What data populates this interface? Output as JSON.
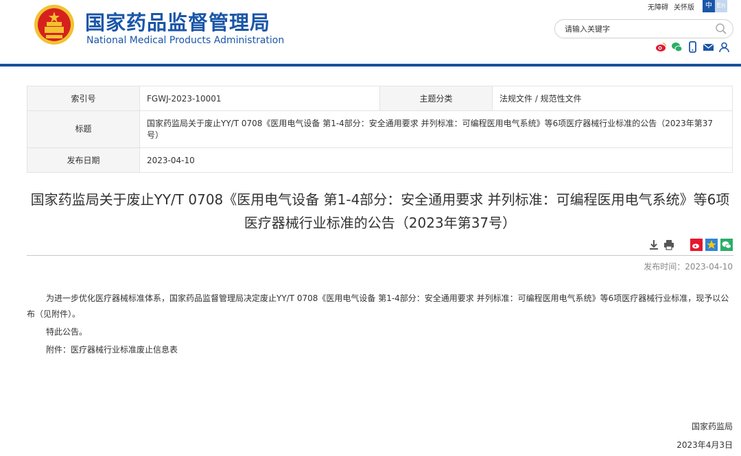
{
  "header": {
    "site_name_cn": "国家药品监督管理局",
    "site_name_en": "National Medical Products Administration",
    "top_links": [
      "无障碍",
      "关怀版"
    ],
    "lang_zh": "中",
    "lang_en": "En",
    "search_placeholder": "请输入关键字",
    "social_icons": [
      "weibo-icon",
      "wechat-icon",
      "mobile-icon",
      "mail-icon",
      "user-icon"
    ]
  },
  "info_table": {
    "index_label": "索引号",
    "index_value": "FGWJ-2023-10001",
    "category_label": "主题分类",
    "category_value": "法规文件 / 规范性文件",
    "title_label": "标题",
    "title_value": "国家药监局关于废止YY/T 0708《医用电气设备 第1-4部分：安全通用要求 并列标准：可编程医用电气系统》等6项医疗器械行业标准的公告（2023年第37号）",
    "date_label": "发布日期",
    "date_value": "2023-04-10"
  },
  "article": {
    "title": "国家药监局关于废止YY/T 0708《医用电气设备 第1-4部分：安全通用要求 并列标准：可编程医用电气系统》等6项医疗器械行业标准的公告（2023年第37号）",
    "pub_time": "发布时间：2023-04-10",
    "paragraph1": "为进一步优化医疗器械标准体系，国家药品监督管理局决定废止YY/T 0708《医用电气设备 第1-4部分：安全通用要求 并列标准：可编程医用电气系统》等6项医疗器械行业标准，现予以公布（见附件）。",
    "paragraph2": "特此公告。",
    "attachment": "附件：医疗器械行业标准废止信息表",
    "signer": "国家药监局",
    "sign_date": "2023年4月3日"
  },
  "colors": {
    "brand_blue": "#1a56a8",
    "rule_blue": "#1a4f9c",
    "emblem_red": "#d6201e",
    "emblem_gold": "#f2c230"
  }
}
